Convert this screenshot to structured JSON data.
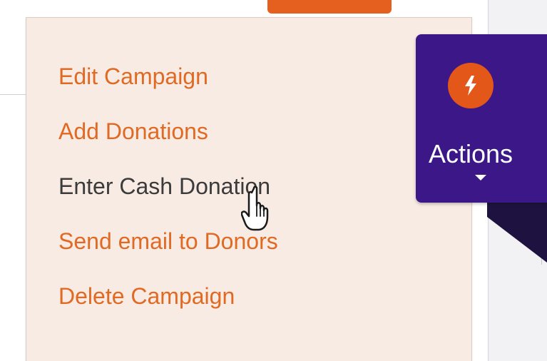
{
  "menu": {
    "items": [
      {
        "label": "Edit Campaign"
      },
      {
        "label": "Add Donations"
      },
      {
        "label": "Enter Cash Donation"
      },
      {
        "label": "Send email to Donors"
      },
      {
        "label": "Delete Campaign"
      }
    ]
  },
  "actions": {
    "label": "Actions",
    "icon": "lightning-bolt-icon"
  },
  "colors": {
    "menu_background": "#f8ebe3",
    "menu_link": "#e06a24",
    "menu_text_active": "#3b3b3b",
    "actions_background": "#3b1788",
    "actions_circle": "#e35718"
  }
}
